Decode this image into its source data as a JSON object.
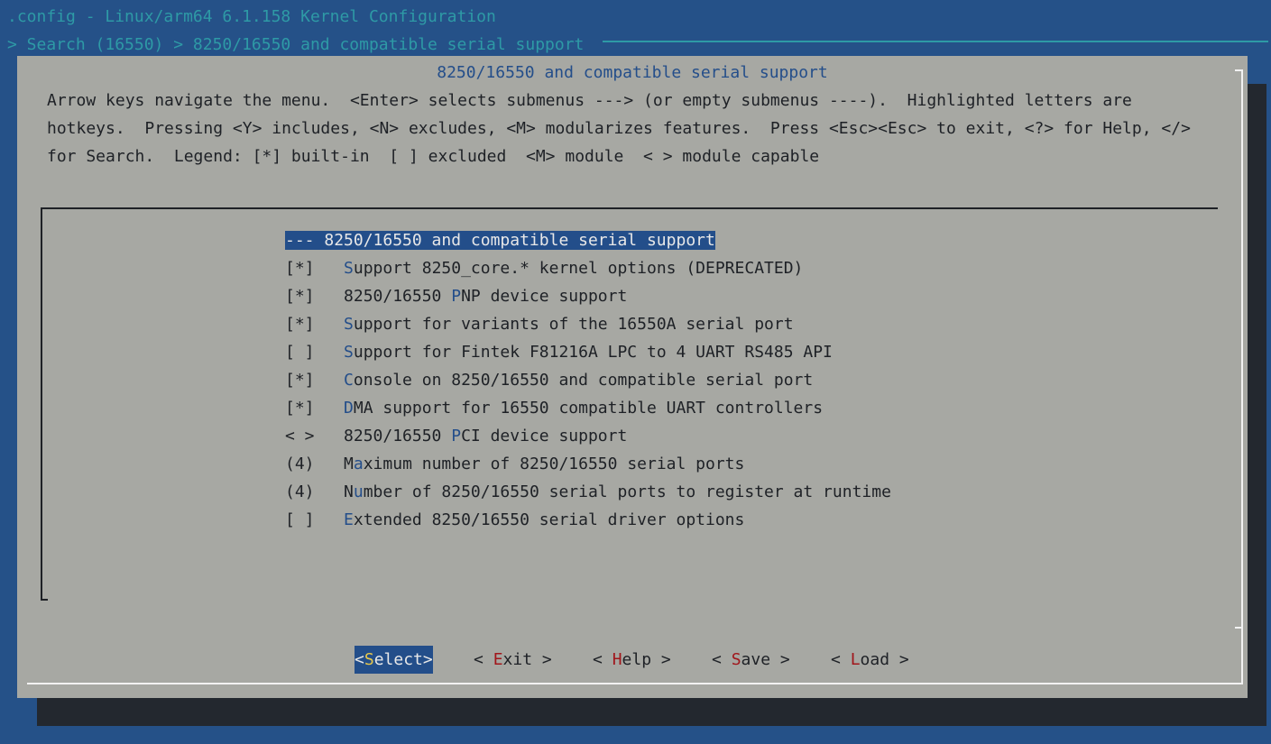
{
  "window": {
    "title": ".config - Linux/arm64 6.1.158 Kernel Configuration",
    "breadcrumb": "> Search (16550) > 8250/16550 and compatible serial support"
  },
  "dialog": {
    "title": "8250/16550 and compatible serial support",
    "help_lines": [
      "Arrow keys navigate the menu.  <Enter> selects submenus ---> (or empty submenus ----).  Highlighted letters are",
      "hotkeys.  Pressing <Y> includes, <N> excludes, <M> modularizes features.  Press <Esc><Esc> to exit, <?> for Help, </>",
      "for Search.  Legend: [*] built-in  [ ] excluded  <M> module  < > module capable"
    ]
  },
  "menu": {
    "items": [
      {
        "marker": "---",
        "pre": " 8250/16550 and compatible serial support",
        "hotkey": "",
        "post": "",
        "selected": true
      },
      {
        "marker": "[*]",
        "pre": "   ",
        "hotkey": "S",
        "post": "upport 8250_core.* kernel options (DEPRECATED)",
        "selected": false
      },
      {
        "marker": "[*]",
        "pre": "   8250/16550 ",
        "hotkey": "P",
        "post": "NP device support",
        "selected": false
      },
      {
        "marker": "[*]",
        "pre": "   ",
        "hotkey": "S",
        "post": "upport for variants of the 16550A serial port",
        "selected": false
      },
      {
        "marker": "[ ]",
        "pre": "   ",
        "hotkey": "S",
        "post": "upport for Fintek F81216A LPC to 4 UART RS485 API",
        "selected": false
      },
      {
        "marker": "[*]",
        "pre": "   ",
        "hotkey": "C",
        "post": "onsole on 8250/16550 and compatible serial port",
        "selected": false
      },
      {
        "marker": "[*]",
        "pre": "   ",
        "hotkey": "D",
        "post": "MA support for 16550 compatible UART controllers",
        "selected": false
      },
      {
        "marker": "< >",
        "pre": "   8250/16550 ",
        "hotkey": "P",
        "post": "CI device support",
        "selected": false
      },
      {
        "marker": "(4)",
        "pre": "   M",
        "hotkey": "a",
        "post": "ximum number of 8250/16550 serial ports",
        "selected": false
      },
      {
        "marker": "(4)",
        "pre": "   N",
        "hotkey": "u",
        "post": "mber of 8250/16550 serial ports to register at runtime",
        "selected": false
      },
      {
        "marker": "[ ]",
        "pre": "   ",
        "hotkey": "E",
        "post": "xtended 8250/16550 serial driver options",
        "selected": false
      }
    ]
  },
  "buttons": {
    "select": {
      "left": "<",
      "hotkey": "S",
      "rest": "elect",
      "right": ">"
    },
    "exit": {
      "left": "< ",
      "hotkey": "E",
      "rest": "xit",
      "right": " >"
    },
    "help": {
      "left": "< ",
      "hotkey": "H",
      "rest": "elp",
      "right": " >"
    },
    "save": {
      "left": "< ",
      "hotkey": "S",
      "rest": "ave",
      "right": " >"
    },
    "load": {
      "left": "< ",
      "hotkey": "L",
      "rest": "oad",
      "right": " >"
    }
  },
  "colors": {
    "background": "#255188",
    "dialog": "#a7a8a3",
    "header_text": "#2e9aa6",
    "highlight": "#234e8a",
    "button_hotkey": "#a1161b",
    "active_button_hotkey": "#e8c84a"
  }
}
